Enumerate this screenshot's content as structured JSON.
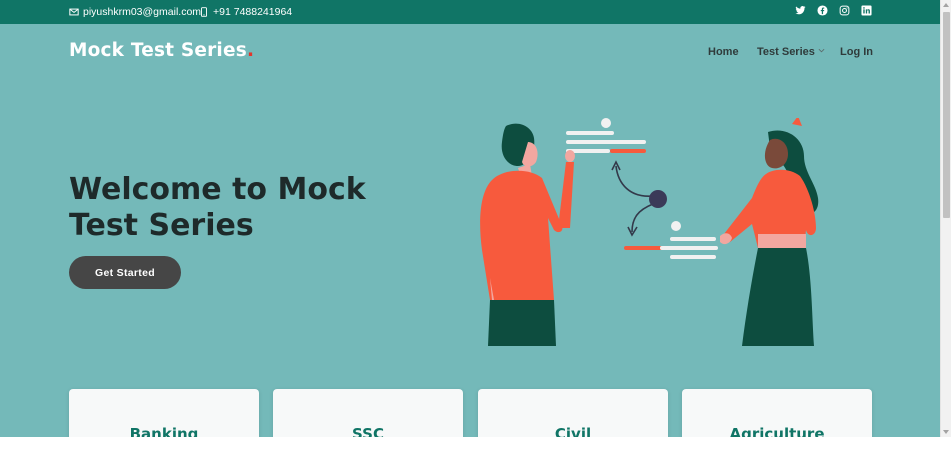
{
  "topbar": {
    "email": "piyushkrm03@gmail.com",
    "phone": "+91 7488241964",
    "email_icon": "envelope-icon",
    "phone_icon": "phone-icon",
    "social_icons": [
      "twitter-icon",
      "facebook-icon",
      "instagram-icon",
      "linkedin-icon"
    ]
  },
  "header": {
    "brand": "Mock Test Series",
    "brand_dot": ".",
    "nav": {
      "home": "Home",
      "test_series": "Test Series",
      "login": "Log In"
    }
  },
  "hero": {
    "title": "Welcome to Mock Test Series",
    "cta_label": "Get Started"
  },
  "cards": [
    "Banking",
    "SSC",
    "Civil",
    "Agriculture"
  ],
  "colors": {
    "topbar": "#107566",
    "background": "#74b9b9",
    "accent": "#e2362b",
    "cta": "#464646",
    "card_text": "#107566",
    "illustration_orange": "#f75a3d",
    "illustration_green": "#0d4d3f"
  }
}
